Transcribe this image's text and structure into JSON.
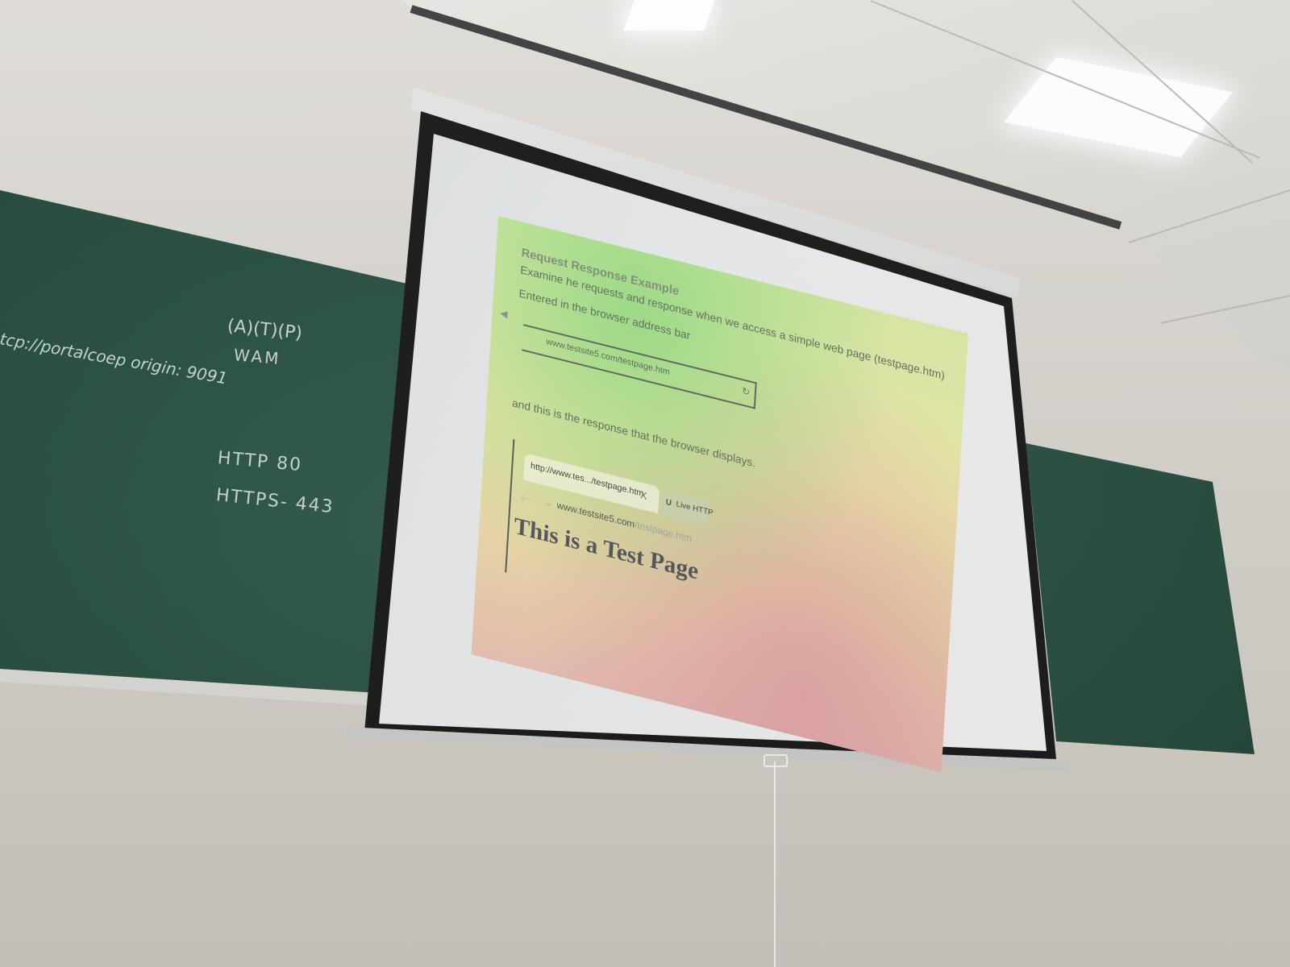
{
  "slide": {
    "title": "Request Response Example",
    "line1": "Examine he requests and response when we access a simple web page (testpage.htm)",
    "line2": "Entered in the browser address bar",
    "address_bar_url": "www.testsite5.com/testpage.htm",
    "line3": "and this is the response that the browser displays.",
    "browser": {
      "tab_title": "http://www.tes.../testpage.htm",
      "tab_close": "X",
      "live_tab_label": "Live HTTP",
      "url_host": "www.testsite5.com",
      "url_path": "/testpage.htm",
      "page_heading": "This is a Test Page"
    }
  },
  "chalkboard": {
    "line_a": "(A)(T)(P)",
    "line_b": "WAM",
    "line_c": "tcp://portalcoep origin: 9091",
    "line_d": "HTTP 80",
    "line_e": "HTTPS- 443"
  },
  "colors": {
    "chalkboard": "#1f4537",
    "wall": "#d4d1cb",
    "screen_border": "#141414"
  }
}
